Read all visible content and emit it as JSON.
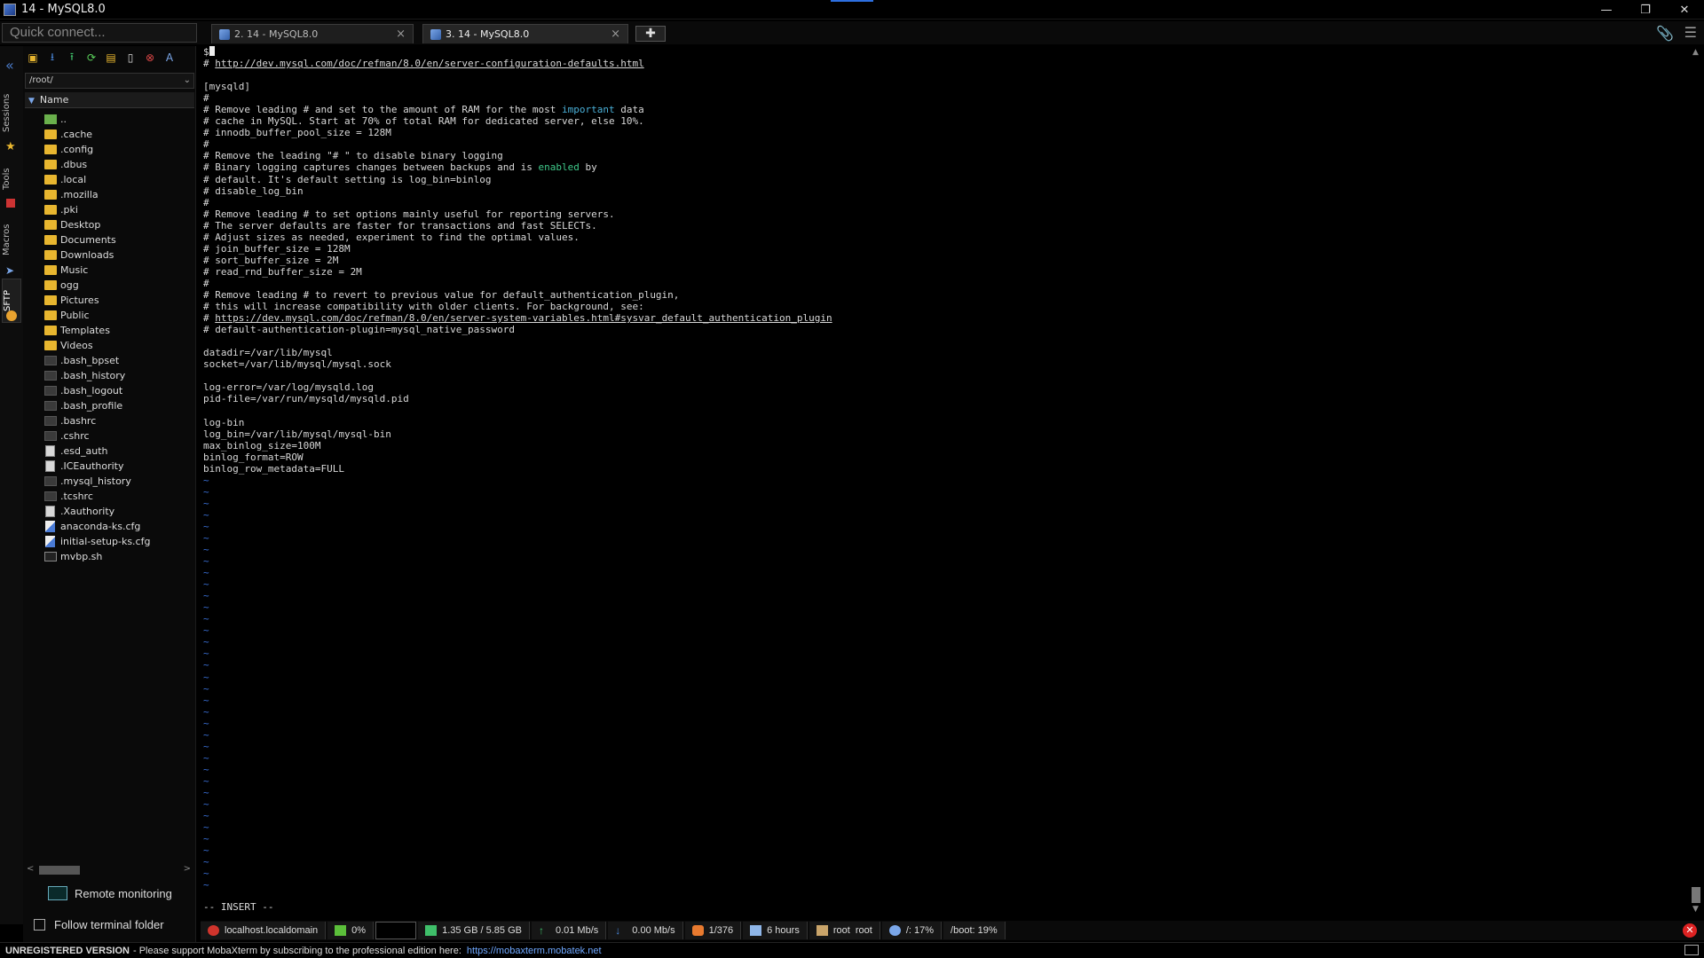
{
  "window": {
    "title": "14 - MySQL8.0",
    "controls": [
      "—",
      "❐",
      "✕"
    ]
  },
  "quick_connect": {
    "placeholder": "Quick connect..."
  },
  "tabs": [
    {
      "label": "2. 14 - MySQL8.0",
      "close": "×"
    },
    {
      "label": "3. 14 - MySQL8.0",
      "close": "×"
    }
  ],
  "side_tabs": [
    "Sessions",
    "Tools",
    "Macros",
    "SFTP"
  ],
  "sidebar": {
    "path": "/root/",
    "column_header": "Name",
    "files": [
      {
        "name": "..",
        "type": "up"
      },
      {
        "name": ".cache",
        "type": "folder"
      },
      {
        "name": ".config",
        "type": "folder"
      },
      {
        "name": ".dbus",
        "type": "folder"
      },
      {
        "name": ".local",
        "type": "folder"
      },
      {
        "name": ".mozilla",
        "type": "folder"
      },
      {
        "name": ".pki",
        "type": "folder"
      },
      {
        "name": "Desktop",
        "type": "folder"
      },
      {
        "name": "Documents",
        "type": "folder"
      },
      {
        "name": "Downloads",
        "type": "folder"
      },
      {
        "name": "Music",
        "type": "folder"
      },
      {
        "name": "ogg",
        "type": "folder"
      },
      {
        "name": "Pictures",
        "type": "folder"
      },
      {
        "name": "Public",
        "type": "folder"
      },
      {
        "name": "Templates",
        "type": "folder"
      },
      {
        "name": "Videos",
        "type": "folder"
      },
      {
        "name": ".bash_bpset",
        "type": "file-d"
      },
      {
        "name": ".bash_history",
        "type": "file-d"
      },
      {
        "name": ".bash_logout",
        "type": "file-d"
      },
      {
        "name": ".bash_profile",
        "type": "file-d"
      },
      {
        "name": ".bashrc",
        "type": "file-d"
      },
      {
        "name": ".cshrc",
        "type": "file-d"
      },
      {
        "name": ".esd_auth",
        "type": "doc"
      },
      {
        "name": ".ICEauthority",
        "type": "doc"
      },
      {
        "name": ".mysql_history",
        "type": "file-d"
      },
      {
        "name": ".tcshrc",
        "type": "file-d"
      },
      {
        "name": ".Xauthority",
        "type": "doc"
      },
      {
        "name": "anaconda-ks.cfg",
        "type": "cfg"
      },
      {
        "name": "initial-setup-ks.cfg",
        "type": "cfg"
      },
      {
        "name": "mvbp.sh",
        "type": "sh"
      }
    ],
    "remote_monitoring": "Remote monitoring",
    "follow_terminal": "Follow terminal folder"
  },
  "terminal": {
    "lines": [
      {
        "t": "$"
      },
      {
        "t": "# ",
        "u": "http://dev.mysql.com/doc/refman/8.0/en/server-configuration-defaults.html"
      },
      {
        "t": ""
      },
      {
        "t": "[mysqld]"
      },
      {
        "t": "#"
      },
      {
        "t": "# Remove leading # and set to the amount of RAM for the most ",
        "hl": "important",
        "hc": "kw-imp",
        "rest": " data"
      },
      {
        "t": "# cache in MySQL. Start at 70% of total RAM for dedicated server, else 10%."
      },
      {
        "t": "# innodb_buffer_pool_size = 128M"
      },
      {
        "t": "#"
      },
      {
        "t": "# Remove the leading \"# \" to disable binary logging"
      },
      {
        "t": "# Binary logging captures changes between backups and is ",
        "hl": "enabled",
        "hc": "kw-en",
        "rest": " by"
      },
      {
        "t": "# default. It's default setting is log_bin=binlog"
      },
      {
        "t": "# disable_log_bin"
      },
      {
        "t": "#"
      },
      {
        "t": "# Remove leading # to set options mainly useful for reporting servers."
      },
      {
        "t": "# The server defaults are faster for transactions and fast SELECTs."
      },
      {
        "t": "# Adjust sizes as needed, experiment to find the optimal values."
      },
      {
        "t": "# join_buffer_size = 128M"
      },
      {
        "t": "# sort_buffer_size = 2M"
      },
      {
        "t": "# read_rnd_buffer_size = 2M"
      },
      {
        "t": "#"
      },
      {
        "t": "# Remove leading # to revert to previous value for default_authentication_plugin,"
      },
      {
        "t": "# this will increase compatibility with older clients. For background, see:"
      },
      {
        "t": "# ",
        "u": "https://dev.mysql.com/doc/refman/8.0/en/server-system-variables.html#sysvar_default_authentication_plugin"
      },
      {
        "t": "# default-authentication-plugin=mysql_native_password"
      },
      {
        "t": ""
      },
      {
        "t": "datadir=/var/lib/mysql"
      },
      {
        "t": "socket=/var/lib/mysql/mysql.sock"
      },
      {
        "t": ""
      },
      {
        "t": "log-error=/var/log/mysqld.log"
      },
      {
        "t": "pid-file=/var/run/mysqld/mysqld.pid"
      },
      {
        "t": ""
      },
      {
        "t": "log-bin"
      },
      {
        "t": "log_bin=/var/lib/mysql/mysql-bin"
      },
      {
        "t": "max_binlog_size=100M"
      },
      {
        "t": "binlog_format=ROW"
      },
      {
        "t": "binlog_row_metadata=FULL"
      }
    ],
    "tilde": "~",
    "tilde_count": 36,
    "mode": "-- INSERT --"
  },
  "status": {
    "host": "localhost.localdomain",
    "cpu": "0%",
    "memory": "1.35 GB / 5.85 GB",
    "upload": "0.01 Mb/s",
    "download": "0.00 Mb/s",
    "sessions": "1/376",
    "uptime": "6 hours",
    "user": "root  root",
    "disk_root": "/: 17%",
    "disk_boot": "/boot: 19%"
  },
  "footer": {
    "unregistered": "UNREGISTERED VERSION",
    "message": " -  Please support MobaXterm by subscribing to the professional edition here:",
    "link": "https://mobaxterm.mobatek.net"
  },
  "colors": {
    "accent": "#2d6fe0",
    "folder": "#e8b62f",
    "tilde": "#3a6fd6",
    "keyword_important": "#4ab0d8",
    "keyword_enabled": "#3fc98a"
  }
}
